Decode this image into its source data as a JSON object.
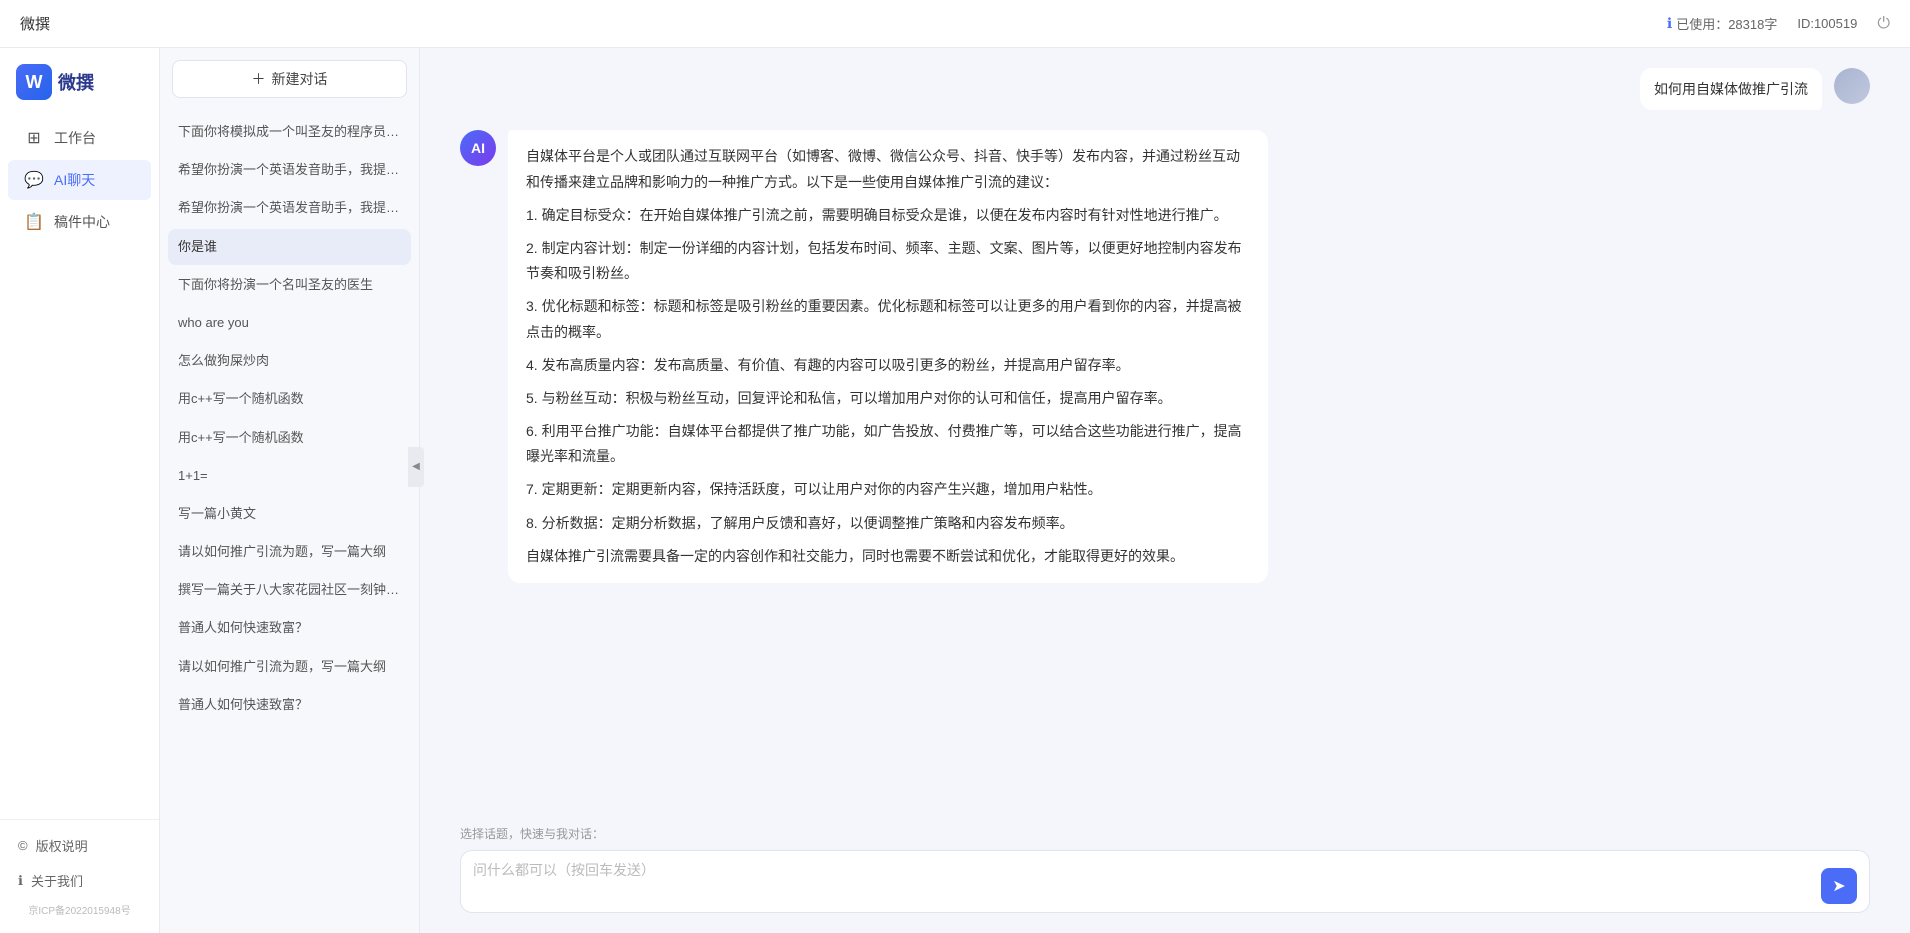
{
  "topbar": {
    "title": "微撰",
    "usage_icon": "ℹ",
    "usage_label": "已使用：28318字",
    "id_label": "ID:100519",
    "power_icon": "⏻"
  },
  "sidebar": {
    "logo_letter": "W",
    "logo_text": "微撰",
    "nav_items": [
      {
        "id": "workspace",
        "icon": "⊞",
        "label": "工作台"
      },
      {
        "id": "aichat",
        "icon": "💬",
        "label": "AI聊天",
        "active": true
      },
      {
        "id": "drafts",
        "icon": "📋",
        "label": "稿件中心"
      }
    ],
    "bottom_items": [
      {
        "id": "copyright",
        "icon": "©",
        "label": "版权说明"
      },
      {
        "id": "about",
        "icon": "ℹ",
        "label": "关于我们"
      }
    ],
    "icp": "京ICP备2022015948号"
  },
  "chat_list": {
    "new_btn": "新建对话",
    "items": [
      {
        "id": "c1",
        "text": "下面你将模拟成一个叫圣友的程序员，我说..."
      },
      {
        "id": "c2",
        "text": "希望你扮演一个英语发音助手，我提供给你..."
      },
      {
        "id": "c3",
        "text": "希望你扮演一个英语发音助手，我提供给你..."
      },
      {
        "id": "c4",
        "text": "你是谁",
        "active": true
      },
      {
        "id": "c5",
        "text": "下面你将扮演一个名叫圣友的医生"
      },
      {
        "id": "c6",
        "text": "who are you"
      },
      {
        "id": "c7",
        "text": "怎么做狗屎炒肉"
      },
      {
        "id": "c8",
        "text": "用c++写一个随机函数"
      },
      {
        "id": "c9",
        "text": "用c++写一个随机函数"
      },
      {
        "id": "c10",
        "text": "1+1="
      },
      {
        "id": "c11",
        "text": "写一篇小黄文"
      },
      {
        "id": "c12",
        "text": "请以如何推广引流为题，写一篇大纲"
      },
      {
        "id": "c13",
        "text": "撰写一篇关于八大家花园社区一刻钟便民生..."
      },
      {
        "id": "c14",
        "text": "普通人如何快速致富？"
      },
      {
        "id": "c15",
        "text": "请以如何推广引流为题，写一篇大纲"
      },
      {
        "id": "c16",
        "text": "普通人如何快速致富？"
      }
    ]
  },
  "chat": {
    "user_message": "如何用自媒体做推广引流",
    "ai_response": {
      "paragraphs": [
        "自媒体平台是个人或团队通过互联网平台（如博客、微博、微信公众号、抖音、快手等）发布内容，并通过粉丝互动和传播来建立品牌和影响力的一种推广方式。以下是一些使用自媒体推广引流的建议：",
        "1. 确定目标受众：在开始自媒体推广引流之前，需要明确目标受众是谁，以便在发布内容时有针对性地进行推广。",
        "2. 制定内容计划：制定一份详细的内容计划，包括发布时间、频率、主题、文案、图片等，以便更好地控制内容发布节奏和吸引粉丝。",
        "3. 优化标题和标签：标题和标签是吸引粉丝的重要因素。优化标题和标签可以让更多的用户看到你的内容，并提高被点击的概率。",
        "4. 发布高质量内容：发布高质量、有价值、有趣的内容可以吸引更多的粉丝，并提高用户留存率。",
        "5. 与粉丝互动：积极与粉丝互动，回复评论和私信，可以增加用户对你的认可和信任，提高用户留存率。",
        "6. 利用平台推广功能：自媒体平台都提供了推广功能，如广告投放、付费推广等，可以结合这些功能进行推广，提高曝光率和流量。",
        "7. 定期更新：定期更新内容，保持活跃度，可以让用户对你的内容产生兴趣，增加用户粘性。",
        "8. 分析数据：定期分析数据，了解用户反馈和喜好，以便调整推广策略和内容发布频率。",
        "自媒体推广引流需要具备一定的内容创作和社交能力，同时也需要不断尝试和优化，才能取得更好的效果。"
      ]
    }
  },
  "input": {
    "quick_topics_label": "选择话题，快速与我对话：",
    "placeholder": "问什么都可以（按回车发送）",
    "send_icon": "➤"
  }
}
